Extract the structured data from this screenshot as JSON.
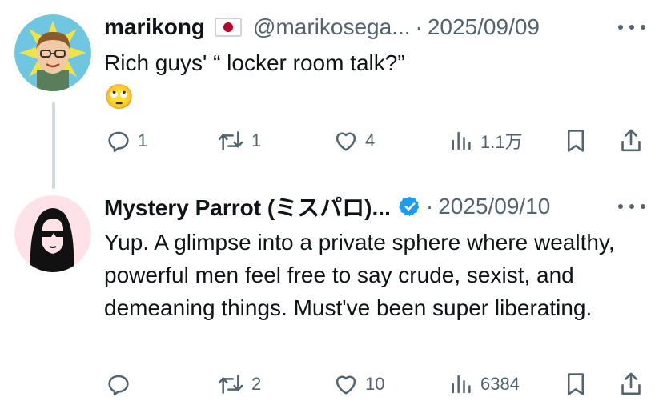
{
  "posts": [
    {
      "author": "marikong",
      "handle": "@marikosega...",
      "separator": "·",
      "date": "2025/09/09",
      "text": "Rich guys' “ locker room talk?”",
      "emoji": "🙄",
      "stats": {
        "replies": "1",
        "reposts": "1",
        "likes": "4",
        "views": "1.1万"
      }
    },
    {
      "author": "Mystery Parrot (ミスパロ)...",
      "handle": "",
      "separator": "·",
      "date": "2025/09/10",
      "text": "Yup. A glimpse into a private sphere where wealthy, powerful men feel free to say crude, sexist, and demeaning things. Must've been super liberating.",
      "stats": {
        "replies": "",
        "reposts": "2",
        "likes": "10",
        "views": "6384"
      }
    }
  ],
  "colors": {
    "text": "#0f1419",
    "muted": "#536471",
    "verified": "#1d9bf0",
    "thread_line": "#cfd9de"
  },
  "icons": [
    "reply-icon",
    "repost-icon",
    "like-icon",
    "views-icon",
    "bookmark-icon",
    "share-icon",
    "more-icon",
    "verified-badge-icon",
    "japan-flag-icon"
  ]
}
